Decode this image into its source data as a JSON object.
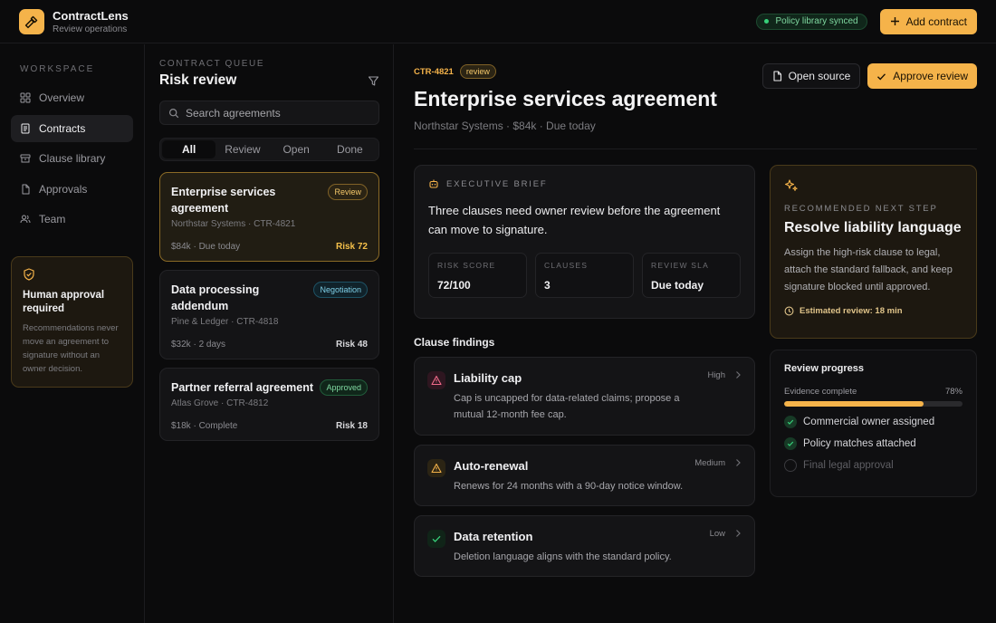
{
  "app": {
    "name": "ContractLens",
    "subtitle": "Review operations",
    "sync_status": "Policy library synced",
    "add_contract_label": "Add contract"
  },
  "sidebar": {
    "section_label": "WORKSPACE",
    "items": [
      {
        "label": "Overview",
        "icon": "grid-icon",
        "active": false
      },
      {
        "label": "Contracts",
        "icon": "document-icon",
        "active": true
      },
      {
        "label": "Clause library",
        "icon": "archive-icon",
        "active": false
      },
      {
        "label": "Approvals",
        "icon": "file-icon",
        "active": false
      },
      {
        "label": "Team",
        "icon": "users-icon",
        "active": false
      }
    ],
    "approval_card": {
      "title": "Human approval required",
      "text": "Recommendations never move an agreement to signature without an owner decision."
    }
  },
  "queue": {
    "eyebrow": "CONTRACT QUEUE",
    "title": "Risk review",
    "search_placeholder": "Search agreements",
    "filters": [
      {
        "label": "All",
        "active": true
      },
      {
        "label": "Review",
        "active": false
      },
      {
        "label": "Open",
        "active": false
      },
      {
        "label": "Done",
        "active": false
      }
    ],
    "cards": [
      {
        "title": "Enterprise services agreement",
        "badge": "Review",
        "meta": "Northstar Systems · CTR-4821",
        "value_due": "$84k · Due today",
        "risk": "Risk 72"
      },
      {
        "title": "Data processing addendum",
        "badge": "Negotiation",
        "meta": "Pine & Ledger · CTR-4818",
        "value_due": "$32k · 2 days",
        "risk": "Risk 48"
      },
      {
        "title": "Partner referral agreement",
        "badge": "Approved",
        "meta": "Atlas Grove · CTR-4812",
        "value_due": "$18k · Complete",
        "risk": "Risk 18"
      }
    ]
  },
  "main": {
    "contract_id": "CTR-4821",
    "status": "review",
    "title": "Enterprise services agreement",
    "subtitle": "Northstar Systems · $84k · Due today",
    "open_source_label": "Open source",
    "approve_label": "Approve review",
    "brief": {
      "eyebrow": "EXECUTIVE BRIEF",
      "text": "Three clauses need owner review before the agreement can move to signature.",
      "stats": [
        {
          "label": "RISK SCORE",
          "value": "72/100"
        },
        {
          "label": "CLAUSES",
          "value": "3"
        },
        {
          "label": "REVIEW SLA",
          "value": "Due today"
        }
      ]
    },
    "findings_label": "Clause findings",
    "findings": [
      {
        "title": "Liability cap",
        "severity": "High",
        "text": "Cap is uncapped for data-related claims; propose a mutual 12-month fee cap."
      },
      {
        "title": "Auto-renewal",
        "severity": "Medium",
        "text": "Renews for 24 months with a 90-day notice window."
      },
      {
        "title": "Data retention",
        "severity": "Low",
        "text": "Deletion language aligns with the standard policy."
      }
    ],
    "next_step": {
      "eyebrow": "RECOMMENDED NEXT STEP",
      "title": "Resolve liability language",
      "text": "Assign the high-risk clause to legal, attach the standard fallback, and keep signature blocked until approved.",
      "eta": "Estimated review: 18 min"
    },
    "progress": {
      "title": "Review progress",
      "evidence_label": "Evidence complete",
      "evidence_percent": "78%",
      "evidence_value": 78,
      "items": [
        {
          "label": "Commercial owner assigned",
          "done": true
        },
        {
          "label": "Policy matches attached",
          "done": true
        },
        {
          "label": "Final legal approval",
          "done": false
        }
      ]
    }
  },
  "colors": {
    "accent": "#f5b34a",
    "success": "#37d07a",
    "danger": "#f06b8a",
    "background": "#0b0b0c"
  }
}
